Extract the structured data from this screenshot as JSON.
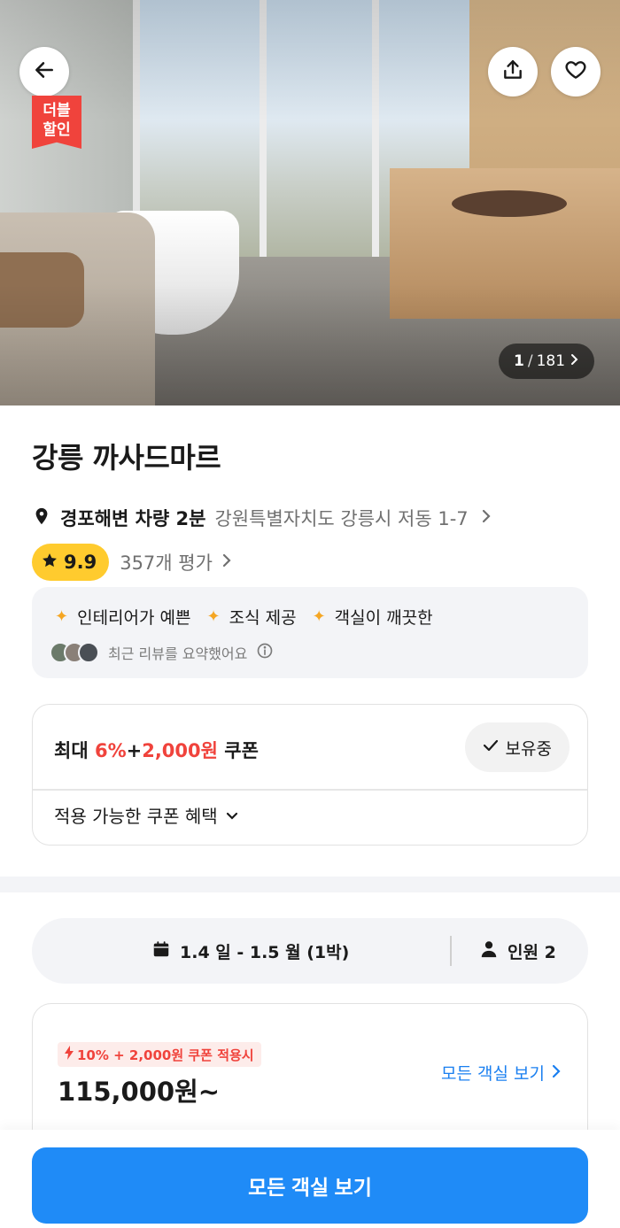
{
  "hero": {
    "badge_line1": "더블",
    "badge_line2": "할인",
    "photo_current": "1",
    "photo_separator": "/",
    "photo_total": "181",
    "icons": [
      "back-arrow-icon",
      "share-icon",
      "heart-icon"
    ]
  },
  "hotel": {
    "name": "강릉 까사드마르",
    "location_highlight": "경포해변 차량 2분",
    "address": "강원특별자치도 강릉시 저동 1-7",
    "rating": "9.9",
    "review_count": "357개 평가"
  },
  "summary": {
    "tags": [
      "인테리어가 예쁜",
      "조식 제공",
      "객실이 깨끗한"
    ],
    "note": "최근 리뷰를 요약했어요"
  },
  "coupon": {
    "prefix": "최대 ",
    "highlight": "6%",
    "plus": "+",
    "highlight2": "2,000원",
    "suffix": " 쿠폰",
    "owned_label": "보유중",
    "benefits_label": "적용 가능한 쿠폰 혜택"
  },
  "booking": {
    "dates": "1.4 일 - 1.5 월 (1박)",
    "guests": "인원 2"
  },
  "price_card": {
    "promo": "10% + 2,000원 쿠폰 적용시",
    "price": "115,000원~",
    "link_label": "모든 객실 보기"
  },
  "cta": {
    "label": "모든 객실 보기"
  },
  "colors": {
    "accent_blue": "#1f8bf7",
    "discount_red": "#f0433c",
    "rating_yellow": "#ffcb2e"
  }
}
